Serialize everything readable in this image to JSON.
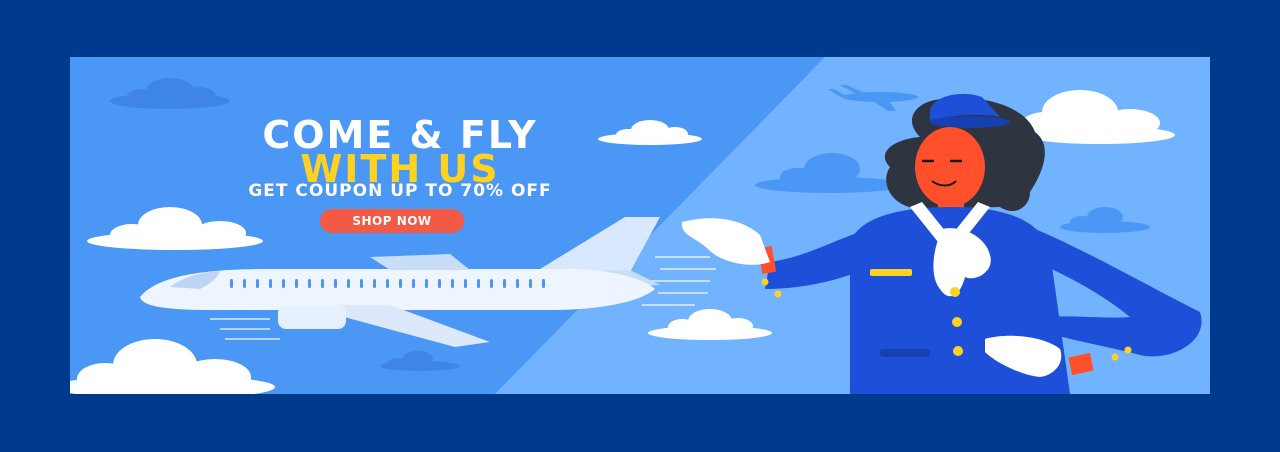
{
  "banner": {
    "headline_line1": "COME & FLY",
    "headline_line2": "WITH US",
    "subheadline": "GET COUPON UP TO 70% OFF",
    "cta_label": "SHOP NOW"
  },
  "colors": {
    "frame": "#003a8c",
    "sky_dark": "#4a97f5",
    "sky_light": "#72b3ff",
    "headline_white": "#ffffff",
    "headline_yellow": "#ffd21f",
    "cta_bg": "#f25a45",
    "uniform_blue": "#1e4fd8",
    "skin": "#ff4f2b"
  },
  "icons": [
    "cloud-icon",
    "airplane-icon",
    "small-airplane-icon",
    "flight-attendant-illustration"
  ]
}
